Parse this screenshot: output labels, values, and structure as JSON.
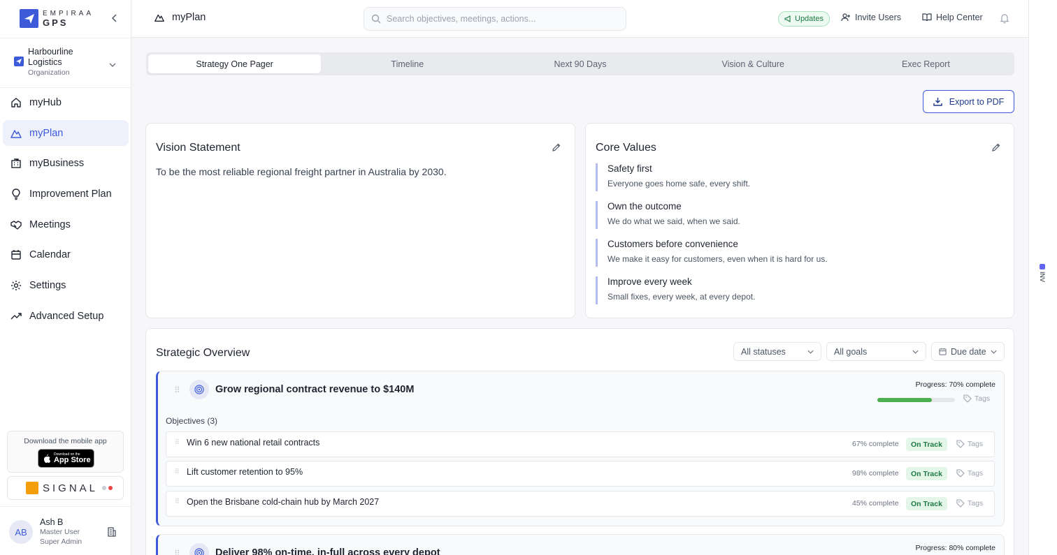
{
  "brand": {
    "line1": "EMPIRAA",
    "line2": "GPS"
  },
  "org": {
    "name": "Harbourline Logistics",
    "type": "Organization"
  },
  "nav": [
    {
      "label": "myHub",
      "icon": "home-icon"
    },
    {
      "label": "myPlan",
      "icon": "mountain-icon",
      "active": true
    },
    {
      "label": "myBusiness",
      "icon": "building-icon"
    },
    {
      "label": "Improvement Plan",
      "icon": "lightbulb-icon"
    },
    {
      "label": "Meetings",
      "icon": "handshake-icon"
    },
    {
      "label": "Calendar",
      "icon": "calendar-icon"
    },
    {
      "label": "Settings",
      "icon": "gear-icon"
    },
    {
      "label": "Advanced Setup",
      "icon": "trend-icon"
    }
  ],
  "mobile": {
    "text": "Download the mobile app",
    "store_small": "Download on the",
    "store_big": "App Store"
  },
  "signal": {
    "text": "SIGNAL",
    "dot1": "#c8ccd4",
    "dot2": "#ef4444"
  },
  "user": {
    "initials": "AB",
    "name": "Ash B",
    "role1": "Master User",
    "role2": "Super Admin"
  },
  "header": {
    "title": "myPlan",
    "search_placeholder": "Search objectives, meetings, actions...",
    "updates": "Updates",
    "invite": "Invite Users",
    "help": "Help Center"
  },
  "side_tag": "INV",
  "tabs": [
    "Strategy One Pager",
    "Timeline",
    "Next 90 Days",
    "Vision & Culture",
    "Exec Report"
  ],
  "export_label": "Export to PDF",
  "vision": {
    "title": "Vision Statement",
    "text": "To be the most reliable regional freight partner in Australia by 2030."
  },
  "core_values": {
    "title": "Core Values",
    "items": [
      {
        "title": "Safety first",
        "desc": "Everyone goes home safe, every shift."
      },
      {
        "title": "Own the outcome",
        "desc": "We do what we said, when we said."
      },
      {
        "title": "Customers before convenience",
        "desc": "We make it easy for customers, even when it is hard for us."
      },
      {
        "title": "Improve every week",
        "desc": "Small fixes, every week, at every depot."
      }
    ]
  },
  "overview": {
    "title": "Strategic Overview",
    "filters": {
      "status": "All statuses",
      "goals": "All goals",
      "due": "Due date"
    },
    "goals": [
      {
        "title": "Grow regional contract revenue to $140M",
        "progress_label": "Progress: 70% complete",
        "progress": 70,
        "tags": "Tags",
        "objectives_label": "Objectives (3)",
        "objectives": [
          {
            "title": "Win 6 new national retail contracts",
            "pct": "67% complete",
            "status": "On Track",
            "tags": "Tags"
          },
          {
            "title": "Lift customer retention to 95%",
            "pct": "98% complete",
            "status": "On Track",
            "tags": "Tags"
          },
          {
            "title": "Open the Brisbane cold-chain hub by March 2027",
            "pct": "45% complete",
            "status": "On Track",
            "tags": "Tags"
          }
        ]
      },
      {
        "title": "Deliver 98% on-time, in-full across every depot",
        "progress_label": "Progress: 80% complete",
        "progress": 80
      }
    ]
  },
  "colors": {
    "accent": "#3d5bd9",
    "success": "#4caf50",
    "value_bar": "#b4bcef"
  }
}
